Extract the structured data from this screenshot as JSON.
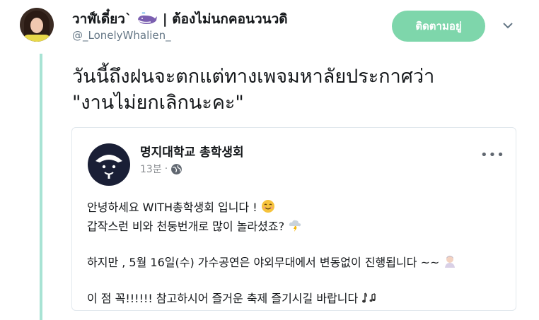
{
  "tweet": {
    "display_name": "วาฬ์เดี๋ยว`",
    "name_suffix": " | ต้องไม่นกคอนวนวดิ",
    "handle": "@_LonelyWhalien_",
    "follow_label": "ติดตามอยู่",
    "text": "วันนี้ถึงฝนจะตกแต่ทางเพจมหาลัยประกาศว่า\n\"งานไม่ยกเลิกนะคะ\""
  },
  "card": {
    "page_name": "명지대학교 총학생회",
    "time": "13분",
    "separator": "·",
    "more_label": "•••",
    "lines": [
      "안녕하세요 WITH총학생회 입니다 !",
      "갑작스런 비와 천둥번개로 많이 놀라셨죠?",
      "하지만 , 5월 16일(수) 가수공연은 야외무대에서 변동없이 진행됩니다 ~~",
      "이 점 꼭!!!!!! 참고하시어 즐거운 축제 즐기시길 바랍니다"
    ]
  },
  "colors": {
    "accent": "#7ed6ab",
    "thread_line": "#a8e3d4",
    "text": "#14171a",
    "muted": "#657786"
  },
  "icons": [
    "whale-icon",
    "chevron-down-icon",
    "globe-icon",
    "more-icon",
    "smile-emoji",
    "storm-emoji",
    "person-emoji",
    "music-notes-emoji"
  ]
}
